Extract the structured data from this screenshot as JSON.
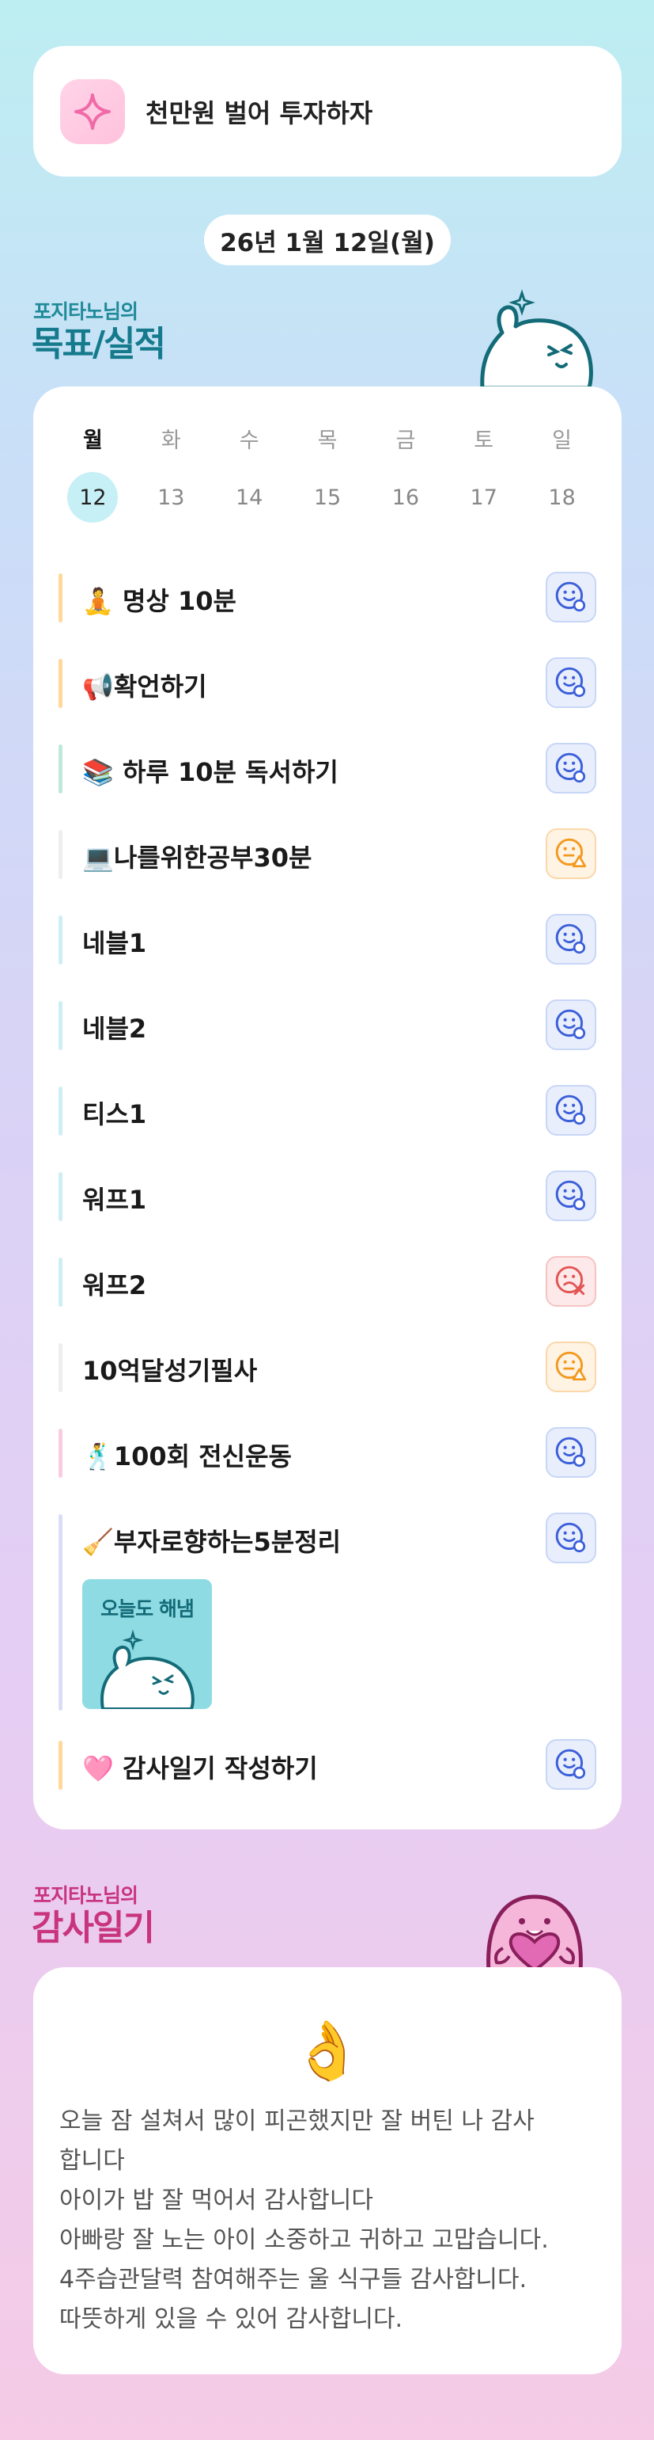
{
  "header": {
    "title": "천만원 벌어 투자하자",
    "icon": "sparkle-icon"
  },
  "date_label": "26년 1월 12일(월)",
  "goals_section": {
    "owner": "포지타노님의",
    "title": "목표/실적"
  },
  "week": {
    "days": [
      "월",
      "화",
      "수",
      "목",
      "금",
      "토",
      "일"
    ],
    "dates": [
      "12",
      "13",
      "14",
      "15",
      "16",
      "17",
      "18"
    ],
    "selected_index": 0
  },
  "goals": [
    {
      "label": "🧘 명상 10분",
      "status": "done",
      "bar_color": "#ffd89a"
    },
    {
      "label": "📢확언하기",
      "status": "done",
      "bar_color": "#ffd89a"
    },
    {
      "label": "📚 하루 10분 독서하기",
      "status": "done",
      "bar_color": "#bfe9d9"
    },
    {
      "label": "💻나를위한공부30분",
      "status": "partial",
      "bar_color": "#eeeeee"
    },
    {
      "label": "네블1",
      "status": "done",
      "bar_color": "#cdeef5"
    },
    {
      "label": "네블2",
      "status": "done",
      "bar_color": "#cdeef5"
    },
    {
      "label": "티스1",
      "status": "done",
      "bar_color": "#cdeef5"
    },
    {
      "label": "워프1",
      "status": "done",
      "bar_color": "#cdeef5"
    },
    {
      "label": "워프2",
      "status": "fail",
      "bar_color": "#cdeef5"
    },
    {
      "label": "10억달성기필사",
      "status": "partial",
      "bar_color": "#eeeeee"
    },
    {
      "label": "🕺100회 전신운동",
      "status": "done",
      "bar_color": "#f9cde0"
    },
    {
      "label": "🧹부자로향하는5분정리",
      "status": "done",
      "bar_color": "#d9ddf5",
      "badge_text": "오늘도 해냄"
    },
    {
      "label": "🩷 감사일기 작성하기",
      "status": "done",
      "bar_color": "#ffd89a"
    }
  ],
  "gratitude_section": {
    "owner": "포지타노님의",
    "title": "감사일기",
    "emoji": "👌",
    "lines": [
      "오늘 잠 설쳐서 많이 피곤했지만 잘 버틴 나 감사",
      "합니다",
      "아이가 밥 잘 먹어서 감사합니다",
      "아빠랑 잘 노는 아이 소중하고 귀하고 고맙습니다.",
      "4주습관달력 참여해주는 울 식구들 감사합니다.",
      "따뜻하게 있을 수 있어 감사합니다."
    ]
  },
  "colors": {
    "done": "#3b5fd9",
    "partial": "#f29a1f",
    "fail": "#e35555"
  }
}
